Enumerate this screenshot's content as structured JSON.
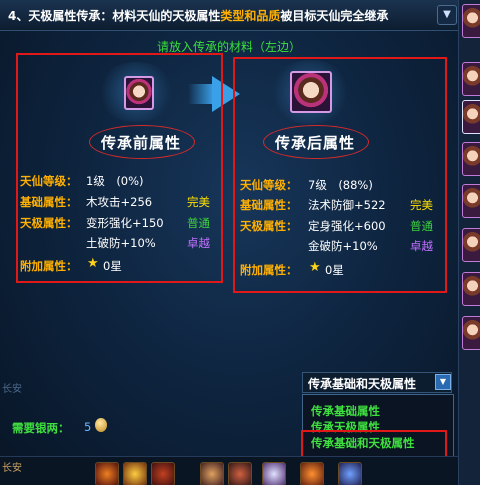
{
  "header": {
    "title_prefix": "4、天极属性传承：材料天仙的天极属性",
    "title_highlight": "类型和品质",
    "title_suffix": "被目标天仙完全继承"
  },
  "hint": "请放入传承的材料（左边）",
  "source": {
    "title": "传承前属性",
    "level_label": "天仙等级：",
    "level_value": "1级　(0%)",
    "base_label": "基础属性：",
    "base_attr": "木攻击+256",
    "base_quality": "完美",
    "tianji_label": "天极属性：",
    "tianji_1": "变形强化+150",
    "tianji_1_quality": "普通",
    "tianji_2": "土破防+10%",
    "tianji_2_quality": "卓越",
    "extra_label": "附加属性：",
    "extra_value": "0星"
  },
  "target": {
    "title": "传承后属性",
    "level_label": "天仙等级：",
    "level_value": "7级　(88%)",
    "base_label": "基础属性：",
    "base_attr": "法术防御+522",
    "base_quality": "完美",
    "tianji_label": "天极属性：",
    "tianji_1": "定身强化+600",
    "tianji_1_quality": "普通",
    "tianji_2": "金破防+10%",
    "tianji_2_quality": "卓越",
    "extra_label": "附加属性：",
    "extra_value": "0星"
  },
  "dropdown": {
    "selected": "传承基础和天极属性",
    "options": [
      "传承基础属性",
      "传承天极属性",
      "传承基础和天极属性"
    ]
  },
  "cost": {
    "label": "需要银两：",
    "value": "5"
  },
  "location": "长安",
  "faded_label": "长安",
  "icons": {
    "star": "star-icon",
    "coin": "coin-icon",
    "arrow": "right-arrow-icon",
    "dropdown": "chevron-down-icon"
  },
  "colors": {
    "label": "#ffb000",
    "perfect": "#ffe000",
    "common": "#3ed33e",
    "excellent": "#c070ff",
    "highlight_box": "#e01818"
  }
}
